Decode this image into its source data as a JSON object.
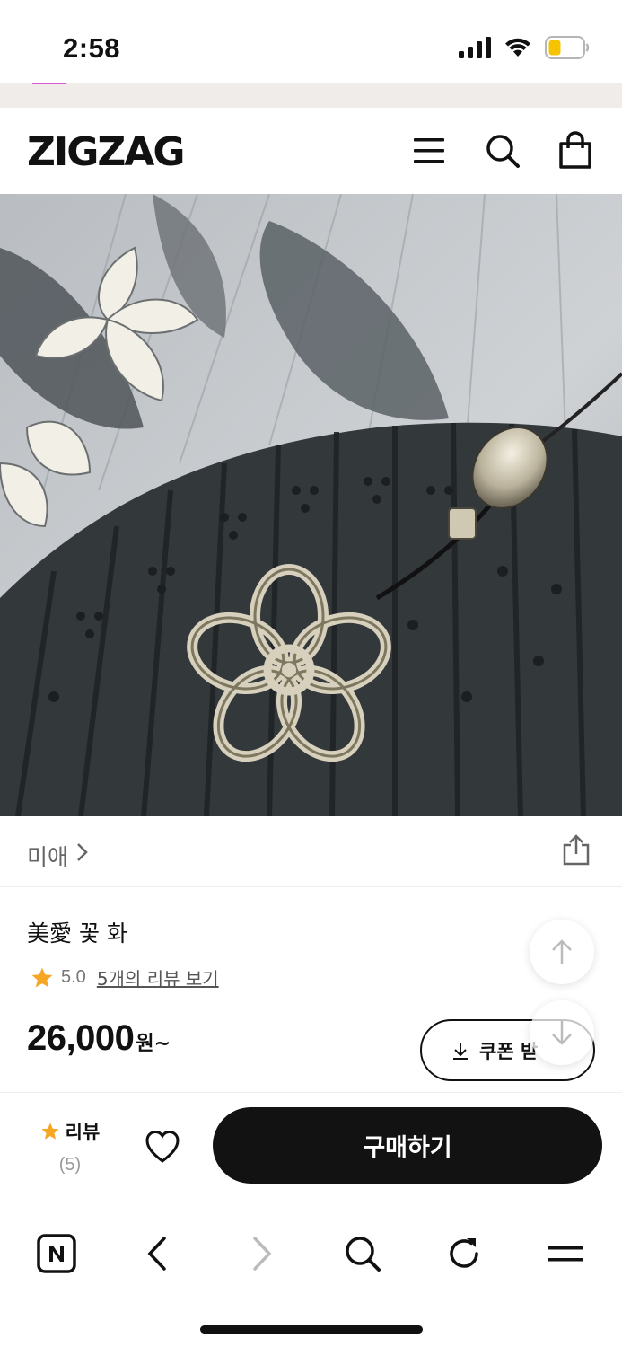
{
  "status_bar": {
    "time": "2:58"
  },
  "header": {
    "logo": "ZIGZAG"
  },
  "shop": {
    "name": "미애"
  },
  "product": {
    "title": "美愛 꽃 화",
    "rating": "5.0",
    "rating_stars": 5.0,
    "review_link": "5개의 리뷰 보기",
    "price": "26,000",
    "price_unit": "원~"
  },
  "coupon": {
    "label": "쿠폰 받"
  },
  "buy_bar": {
    "review_label": "리뷰",
    "review_count": "(5)",
    "buy_label": "구매하기"
  },
  "colors": {
    "accent": "#d65ad9",
    "star": "#f5a623",
    "buy_button": "#121212",
    "battery": "#f5c400"
  },
  "icons": [
    "menu-icon",
    "search-icon",
    "shopping-bag-icon",
    "share-icon",
    "star-icon",
    "heart-icon",
    "arrow-up-icon",
    "arrow-down-icon",
    "download-icon",
    "naver-home-icon",
    "back-icon",
    "forward-icon",
    "refresh-icon",
    "browser-menu-icon"
  ]
}
